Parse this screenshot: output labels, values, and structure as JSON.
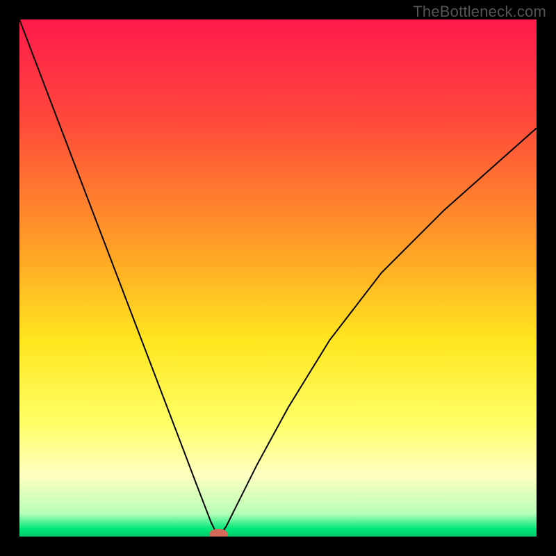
{
  "watermark": "TheBottleneck.com",
  "chart_data": {
    "type": "line",
    "title": "",
    "xlabel": "",
    "ylabel": "",
    "xlim": [
      0,
      100
    ],
    "ylim": [
      0,
      100
    ],
    "grid": false,
    "legend": false,
    "background_gradient_stops": [
      {
        "offset": 0.0,
        "color": "#ff1a4b"
      },
      {
        "offset": 0.2,
        "color": "#ff4a3a"
      },
      {
        "offset": 0.45,
        "color": "#ffa325"
      },
      {
        "offset": 0.62,
        "color": "#ffe61e"
      },
      {
        "offset": 0.78,
        "color": "#ffff66"
      },
      {
        "offset": 0.88,
        "color": "#ffffc0"
      },
      {
        "offset": 0.955,
        "color": "#b8ffb8"
      },
      {
        "offset": 0.985,
        "color": "#00e879"
      },
      {
        "offset": 1.0,
        "color": "#00c96a"
      }
    ],
    "series": [
      {
        "name": "bottleneck-curve",
        "color": "#000000",
        "x": [
          0,
          4,
          8,
          12,
          16,
          20,
          24,
          28,
          32,
          34,
          36,
          37,
          38,
          38.5,
          39,
          40,
          42,
          46,
          52,
          60,
          70,
          82,
          100
        ],
        "y": [
          100,
          89.5,
          79,
          68.5,
          58,
          47.5,
          37,
          26.5,
          16,
          10.7,
          5.5,
          2.9,
          0.8,
          0.2,
          0.5,
          2,
          6,
          14,
          25,
          38,
          51,
          63,
          79
        ]
      }
    ],
    "marker": {
      "name": "bottleneck-marker",
      "x": 38.5,
      "y": 0.4,
      "rx": 1.8,
      "ry": 1.1,
      "color": "#d46a5a"
    }
  }
}
